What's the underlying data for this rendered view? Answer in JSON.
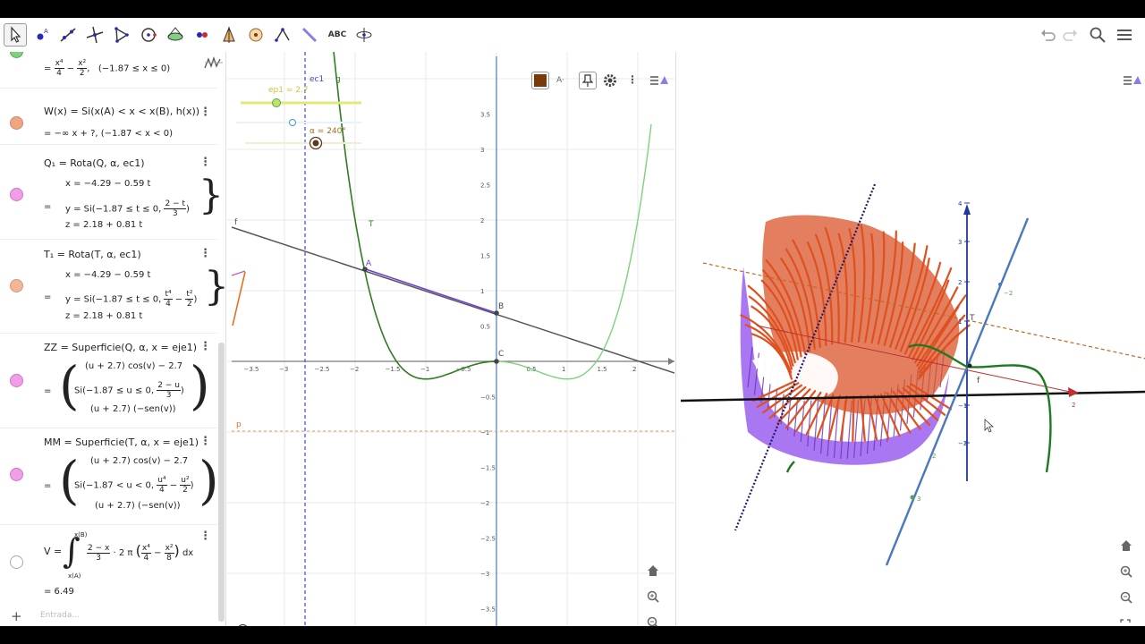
{
  "toolbar": {
    "tools": [
      "move-tool",
      "point-tool",
      "line-tool",
      "perpendicular-tool",
      "polygon-tool",
      "circle-tool",
      "conic-tool",
      "slider-tool",
      "reflect-tool",
      "angle-tool",
      "transform-tool",
      "text-tool",
      "rotate-view-tool"
    ],
    "text_tool_label": "ABC"
  },
  "algebra": {
    "row0": {
      "value_line": "= x⁴/4 − x²/2 ,   (−1.87 ≤ x ≤ 0)",
      "frac_a_num": "x⁴",
      "frac_a_den": "4",
      "frac_b_num": "x²",
      "frac_b_den": "2",
      "range": "(−1.87 ≤ x ≤ 0)"
    },
    "row1": {
      "def": "W(x) = Si(x(A) < x < x(B), h(x))",
      "val": "= −∞ x + ?,    (−1.87 < x < 0)",
      "color": "#e8a07f"
    },
    "row2": {
      "def": "Q₁ = Rota(Q, α, ec1)",
      "x": "x = −4.29 − 0.59 t",
      "y_pre": "y = Si(−1.87 ≤ t ≤ 0,",
      "y_num": "2 − t",
      "y_den": "3",
      "z": "z = 2.18 + 0.81 t",
      "color": "#ef9be6"
    },
    "row3": {
      "def": "T₁ = Rota(T, α, ec1)",
      "x": "x = −4.29 − 0.59 t",
      "y_pre": "y = Si(−1.87 ≤ t ≤ 0,",
      "y_num1": "t⁴",
      "y_den1": "4",
      "y_num2": "t²",
      "y_den2": "2",
      "z": "z = 2.18 + 0.81 t",
      "color": "#f3b792"
    },
    "row4": {
      "def": "ZZ = Superficie(Q, α, x = eje1)",
      "l1": "(u + 2.7)  cos(v) − 2.7",
      "l2_pre": "Si(−1.87 ≤ u ≤ 0,",
      "l2_num": "2 − u",
      "l2_den": "3",
      "l3": "(u + 2.7)  (−sen(v))",
      "color": "#ef9be6"
    },
    "row5": {
      "def": "MM = Superficie(T, α, x = eje1)",
      "l1": "(u + 2.7)  cos(v) − 2.7",
      "l2_pre": "Si(−1.87 < u < 0,",
      "l2_num1": "u⁴",
      "l2_den1": "4",
      "l2_num2": "u²",
      "l2_den2": "2",
      "l3": "(u + 2.7)  (−sen(v))",
      "color": "#ef9be6"
    },
    "row6": {
      "def_pre": "V =",
      "upper": "x(B)",
      "lower": "x(A)",
      "num1": "2 − x",
      "den1": "3",
      "mid": "· 2 π",
      "num2": "x⁴",
      "den2": "4",
      "num3": "x²",
      "den3": "8",
      "tail": "dx",
      "val": "= 6.49"
    },
    "input_placeholder": "Entrada..."
  },
  "graphics2d": {
    "slider_label": "ep1 = 2.7",
    "angle_label": "α = 240°",
    "labels": {
      "ec1": "ec1",
      "g": "g",
      "f": "f",
      "T": "T",
      "A": "A",
      "B": "B",
      "C": "C",
      "p": "p"
    },
    "x_ticks": [
      "−3.5",
      "−3",
      "−2.5",
      "−2",
      "−1.5",
      "−1",
      "−0.5",
      "0",
      "0.5",
      "1",
      "1.5",
      "2"
    ],
    "y_ticks": [
      "3.5",
      "3",
      "2.5",
      "2",
      "1.5",
      "1",
      "0.5",
      "−0.5",
      "−1",
      "−1.5",
      "−2",
      "−2.5",
      "−3",
      "−3.5"
    ],
    "color_swatch": "#7a3a0a"
  },
  "graphics3d": {
    "z_ticks": [
      "4",
      "3",
      "2",
      "1",
      "−1",
      "−2"
    ],
    "labels": {
      "T": "T",
      "f": "f",
      "x2": "2",
      "g2": "2",
      "g3": "3",
      "b2": "−2"
    }
  },
  "colors": {
    "curve_green": "#2e7d1e",
    "line_gray": "#555555",
    "dashed_blue": "#3b4bd8",
    "surface_orange": "#e0501e",
    "surface_purple": "#8a3fe0",
    "axis_blue": "#4a78c0"
  }
}
